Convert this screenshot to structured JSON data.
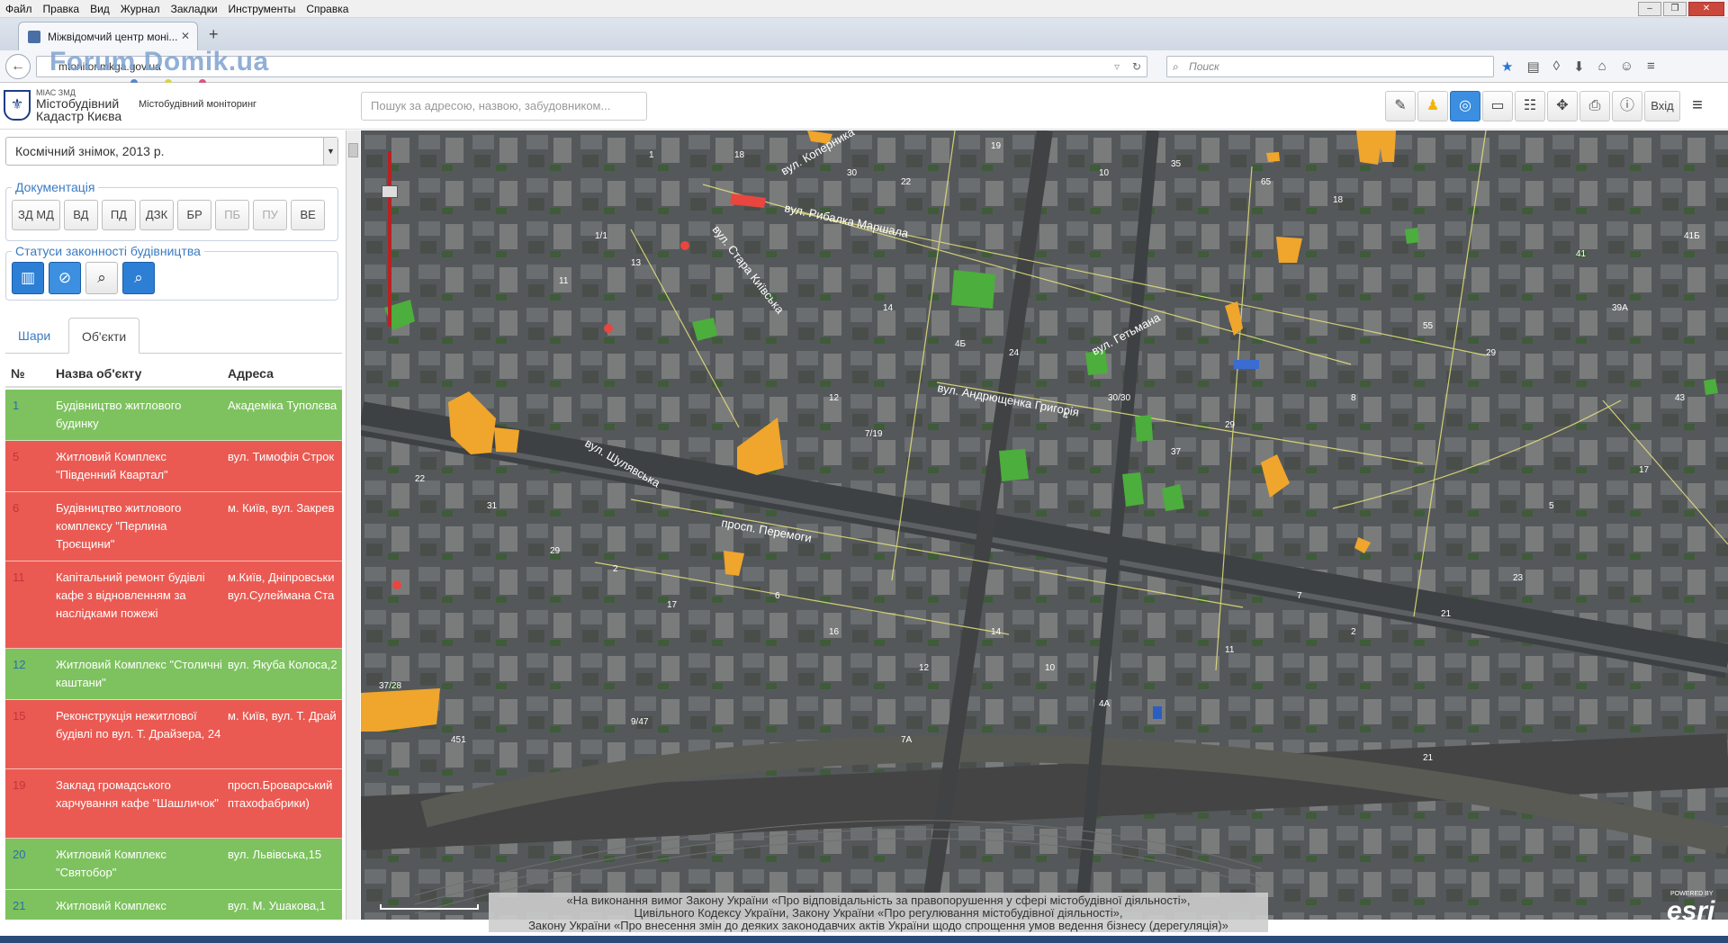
{
  "browser": {
    "menu": [
      "Файл",
      "Правка",
      "Вид",
      "Журнал",
      "Закладки",
      "Инструменты",
      "Справка"
    ],
    "tab_title": "Міжвідомчий центр моні...",
    "url": "mtonitor.mkga.gov.ua",
    "search_placeholder": "Поиск",
    "watermark": "Forum Domik.ua"
  },
  "app": {
    "logo_small": "МІАС ЗМД",
    "logo_line1": "Містобудівний",
    "logo_line2": "Кадастр Києва",
    "logo_subtitle": "Містобудівний моніторинг",
    "search_placeholder": "Пошук за адресою, назвою, забудовником...",
    "login_label": "Вхід",
    "toolbar_icons": [
      "edit-icon",
      "person-icon",
      "compass-icon",
      "ruler-icon",
      "layers-icon",
      "extent-icon",
      "print-icon",
      "info-icon"
    ]
  },
  "sidebar": {
    "layer_select": "Космічний знімок, 2013 р.",
    "docs_legend": "Документація",
    "docs_buttons": [
      "ЗД МД",
      "ВД",
      "ПД",
      "ДЗК",
      "БР",
      "ПБ",
      "ПУ",
      "ВЕ"
    ],
    "statuses_legend": "Статуси законності будівництва",
    "tabs": [
      "Шари",
      "Об'єкти"
    ],
    "columns": [
      "№",
      "Назва об'єкту",
      "Адреса"
    ],
    "rows": [
      {
        "num": "1",
        "name": "Будівництво житлового будинку",
        "addr": "Академіка Туполєва",
        "status": "green"
      },
      {
        "num": "5",
        "name": "Житловий Комплекс \"Південний Квартал\"",
        "addr": "вул. Тимофія Строк",
        "status": "red"
      },
      {
        "num": "6",
        "name": "Будівництво житлового комплексу \"Перлина Троєщини\"",
        "addr": "м. Київ, вул. Закрев",
        "status": "red"
      },
      {
        "num": "11",
        "name": "Капітальний ремонт будівлі кафе з відновленням за наслідками пожежі",
        "addr": "м.Київ, Дніпровськи",
        "addr2": "вул.Сулеймана Ста",
        "status": "red"
      },
      {
        "num": "12",
        "name": "Житловий Комплекс \"Столичні каштани\"",
        "addr": "вул. Якуба Колоса,2",
        "status": "green"
      },
      {
        "num": "15",
        "name": "Реконструкція нежитлової будівлі по вул. Т. Драйзера, 24",
        "addr": "м. Київ, вул. Т. Драй",
        "status": "red"
      },
      {
        "num": "19",
        "name": "Заклад громадського харчування кафе \"Шашличок\"",
        "addr": "просп.Броварський",
        "addr2": "птахофабрики)",
        "status": "red"
      },
      {
        "num": "20",
        "name": "Житловий Комплекс \"Святобор\"",
        "addr": "вул. Львівська,15",
        "status": "green"
      },
      {
        "num": "21",
        "name": "Житловий Комплекс",
        "addr": "вул. М. Ушакова,1",
        "status": "green"
      }
    ]
  },
  "map": {
    "streets": [
      "вул. Рибалка Маршала",
      "вул. Андрющенка Григорія",
      "просп. Перемоги",
      "вул. Шулявська",
      "вул. Стара Київська",
      "вул. Гетьмана",
      "вул. Коперника"
    ],
    "attribution": [
      "«На виконання вимог Закону України «Про відповідальність за правопорушення у сфері містобудівної діяльності»,",
      "Цивільного Кодексу України, Закону України «Про регулювання містобудівної діяльності»,",
      "Закону України «Про внесення змін до деяких законодавчих актів України щодо спрощення умов ведення бізнесу (дерегуляція)»"
    ],
    "esri_powered": "POWERED BY",
    "esri": "esri",
    "colors": {
      "legal": "#4cae3c",
      "violation": "#e8463f",
      "pending": "#f0a52c",
      "road": "#e8e47a"
    }
  }
}
